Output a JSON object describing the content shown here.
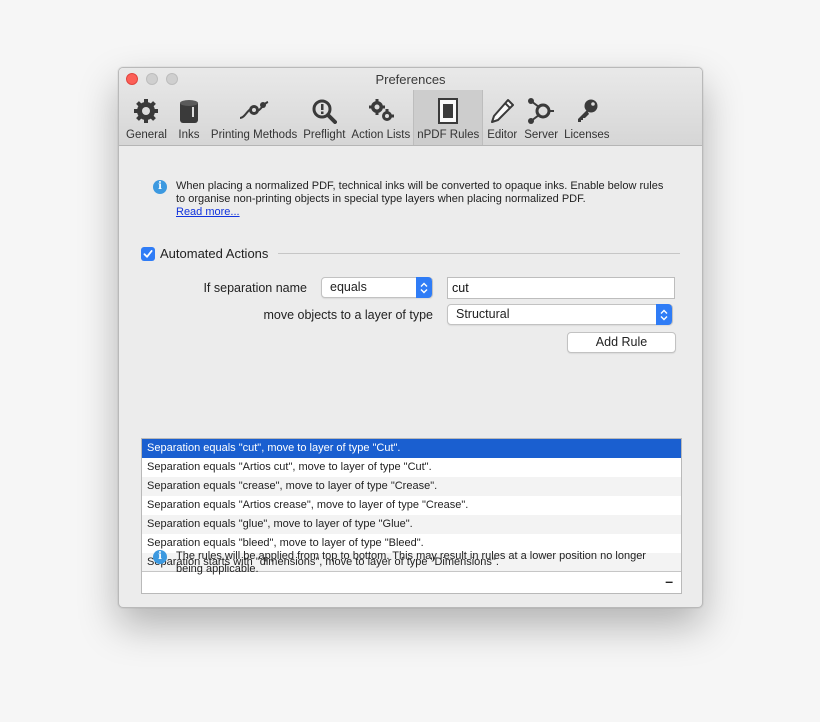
{
  "window": {
    "title": "Preferences"
  },
  "toolbar": {
    "items": [
      {
        "label": "General",
        "icon": "gear-icon"
      },
      {
        "label": "Inks",
        "icon": "ink-can-icon"
      },
      {
        "label": "Printing Methods",
        "icon": "printing-methods-icon"
      },
      {
        "label": "Preflight",
        "icon": "magnifier-icon"
      },
      {
        "label": "Action Lists",
        "icon": "gears-icon"
      },
      {
        "label": "nPDF Rules",
        "icon": "npdf-document-icon"
      },
      {
        "label": "Editor",
        "icon": "pencil-icon"
      },
      {
        "label": "Server",
        "icon": "server-icon"
      },
      {
        "label": "Licenses",
        "icon": "key-icon"
      }
    ],
    "active": "nPDF Rules"
  },
  "intro": {
    "text": "When placing a normalized PDF, technical inks will be converted to opaque inks. Enable below rules to organise non-printing objects in special type layers when placing normalized PDF.",
    "link": "Read more..."
  },
  "automated_actions": {
    "label": "Automated Actions",
    "checked": true
  },
  "form": {
    "separation_label": "If separation name",
    "condition_value": "equals",
    "name_value": "cut",
    "move_label": "move objects to a layer of type",
    "layer_type_value": "Structural",
    "add_rule_label": "Add Rule"
  },
  "rules": [
    "Separation equals \"cut\", move to layer of type \"Cut\".",
    "Separation equals \"Artios cut\", move to layer of type \"Cut\".",
    "Separation equals \"crease\", move to layer of type \"Crease\".",
    "Separation equals \"Artios crease\", move to layer of type \"Crease\".",
    "Separation equals \"glue\", move to layer of type \"Glue\".",
    "Separation equals \"bleed\", move to layer of type \"Bleed\".",
    "Separation starts with \"dimensions\", move to layer of type \"Dimensions\"."
  ],
  "rules_remove_label": "–",
  "footer_note": "The rules will be applied from top to bottom. This may result in rules at a lower position no longer being applicable.",
  "colors": {
    "accent": "#2f7cf6",
    "selection": "#1a5fd0",
    "info": "#3c99e0",
    "close": "#fc5f57"
  }
}
